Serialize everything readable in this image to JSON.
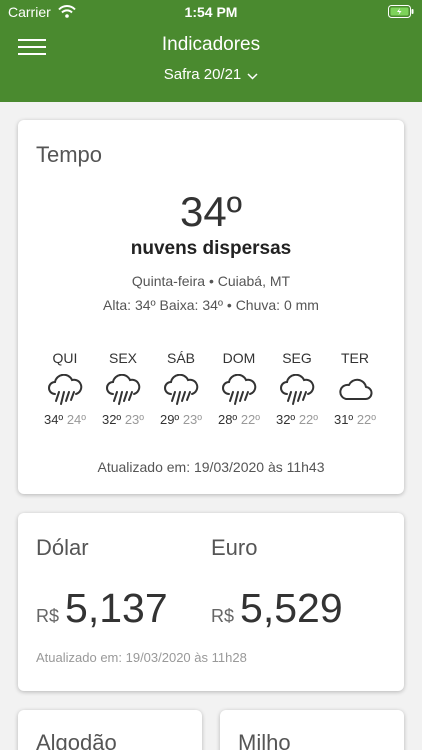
{
  "status_bar": {
    "carrier": "Carrier",
    "time": "1:54 PM"
  },
  "header": {
    "title": "Indicadores",
    "season": "Safra 20/21"
  },
  "weather": {
    "title": "Tempo",
    "temperature": "34º",
    "description": "nuvens dispersas",
    "location": "Quinta-feira • Cuiabá, MT",
    "stats": "Alta: 34º Baixa: 34º • Chuva: 0 mm",
    "forecast": [
      {
        "day": "QUI",
        "icon": "rain-cloud-icon",
        "high": "34º",
        "low": "24º"
      },
      {
        "day": "SEX",
        "icon": "rain-cloud-icon",
        "high": "32º",
        "low": "23º"
      },
      {
        "day": "SÁB",
        "icon": "rain-cloud-icon",
        "high": "29º",
        "low": "23º"
      },
      {
        "day": "DOM",
        "icon": "rain-cloud-icon",
        "high": "28º",
        "low": "22º"
      },
      {
        "day": "SEG",
        "icon": "rain-cloud-icon",
        "high": "32º",
        "low": "22º"
      },
      {
        "day": "TER",
        "icon": "cloud-icon",
        "high": "31º",
        "low": "22º"
      }
    ],
    "updated": "Atualizado em: 19/03/2020 às 11h43"
  },
  "currency": {
    "dollar": {
      "label": "Dólar",
      "symbol": "R$",
      "value": "5,137"
    },
    "euro": {
      "label": "Euro",
      "symbol": "R$",
      "value": "5,529"
    },
    "updated": "Atualizado em: 19/03/2020 às 11h28"
  },
  "commodities": {
    "cotton": "Algodão",
    "corn": "Milho"
  },
  "colors": {
    "header": "#4a8a2f",
    "background": "#f2f2f2"
  }
}
